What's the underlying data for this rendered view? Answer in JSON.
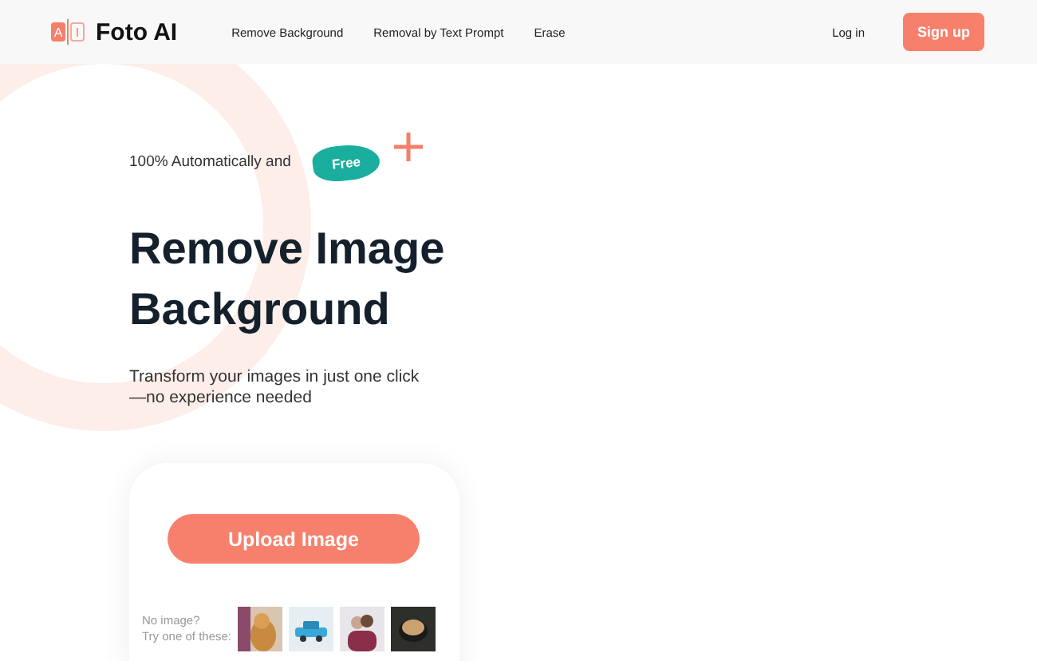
{
  "nav": {
    "logo_letters": [
      "A",
      "I"
    ],
    "brand": "Foto AI",
    "links": [
      "Remove Background",
      "Removal by Text Prompt",
      "Erase"
    ],
    "login": "Log in",
    "signup": "Sign up"
  },
  "hero": {
    "tagline": "100% Automatically and",
    "badge": "Free",
    "title_lines": [
      "Remove Image",
      "Background"
    ],
    "subtitle_lines": [
      "Transform your images in just one click",
      "—no experience needed"
    ]
  },
  "upload": {
    "button": "Upload Image",
    "hint_lines": [
      "No image?",
      "Try one of these:"
    ],
    "samples": [
      {
        "kind": "dog"
      },
      {
        "kind": "car"
      },
      {
        "kind": "couple"
      },
      {
        "kind": "coffee"
      }
    ]
  }
}
